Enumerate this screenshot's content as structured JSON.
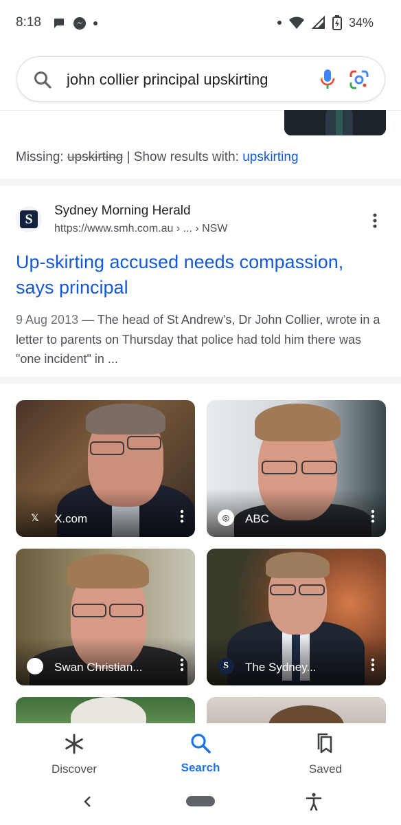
{
  "status_bar": {
    "time": "8:18",
    "battery": "34%"
  },
  "search": {
    "query": "john collier principal upskirting"
  },
  "missing_line": {
    "label": "Missing:",
    "struck_term": "upskirting",
    "separator": "|",
    "show_label": "Show results with:",
    "link": "upskirting"
  },
  "result": {
    "site_name": "Sydney Morning Herald",
    "url": "https://www.smh.com.au › ... › NSW",
    "favicon_letter": "S",
    "title": "Up-skirting accused needs compassion, says principal",
    "date": "9 Aug 2013",
    "snippet": " — The head of St Andrew's, Dr John Collier, wrote in a letter to parents on Thursday that police had told him there was \"one incident\" in ..."
  },
  "images": [
    {
      "source": "X.com",
      "icon": "x-logo-icon"
    },
    {
      "source": "ABC",
      "icon": "abc-logo-icon"
    },
    {
      "source": "Swan Christian...",
      "icon": "circle-logo-icon"
    },
    {
      "source": "The Sydney...",
      "icon": "smh-logo-icon",
      "icon_letter": "S"
    }
  ],
  "bottom_nav": {
    "discover": "Discover",
    "search": "Search",
    "saved": "Saved"
  },
  "colors": {
    "link_blue": "#1558d6",
    "active_blue": "#1a73e8"
  }
}
